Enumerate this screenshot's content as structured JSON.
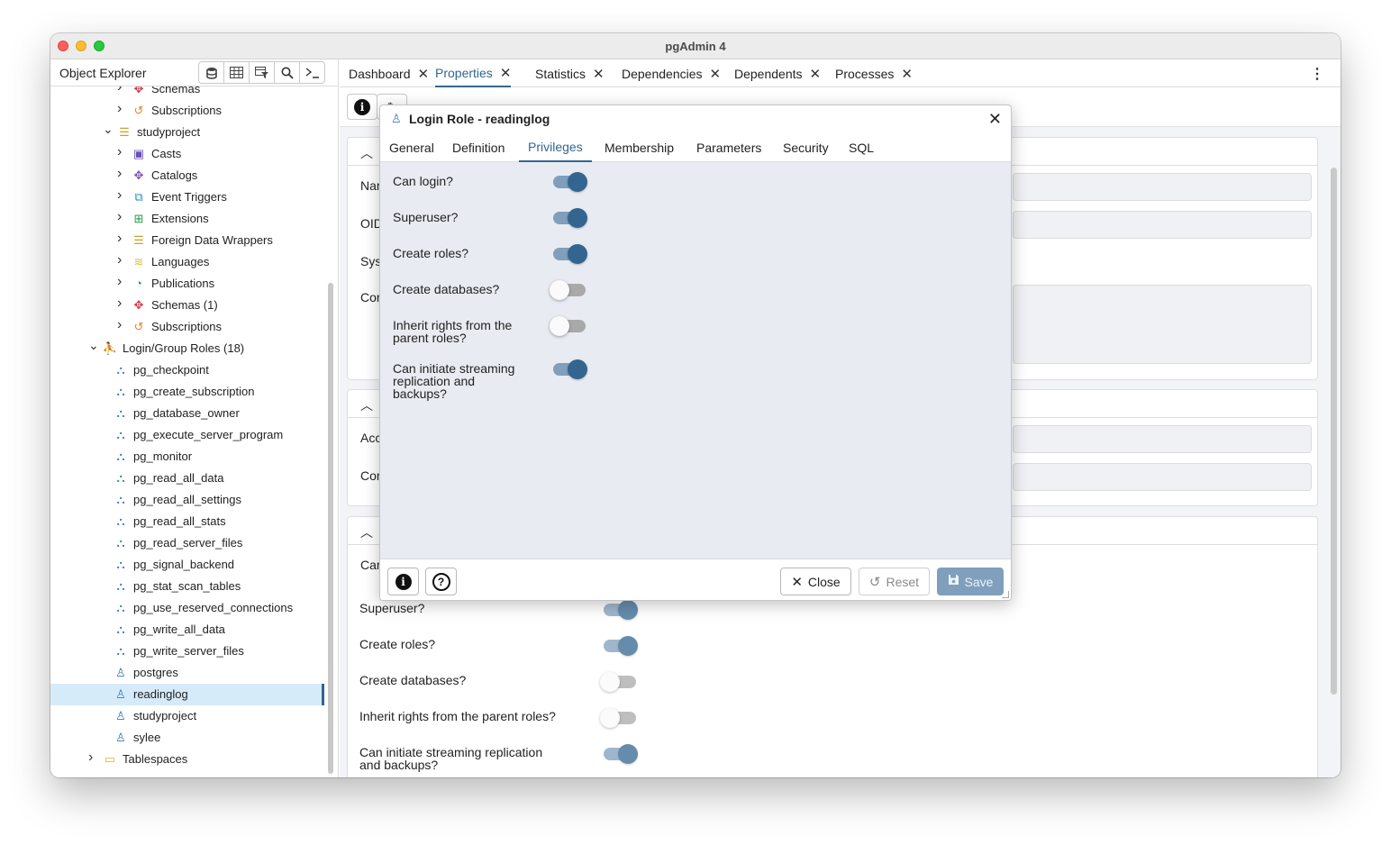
{
  "window": {
    "title": "pgAdmin 4"
  },
  "object_explorer": {
    "title": "Object Explorer",
    "tools": [
      "database-icon",
      "table-icon",
      "filter-icon",
      "search-icon",
      "terminal-icon"
    ],
    "tree": [
      {
        "label": "Schemas",
        "depth": 2,
        "twisty": ">",
        "icon": "schemas-icon",
        "glyph": "✥",
        "color": "#d6334a"
      },
      {
        "label": "Subscriptions",
        "depth": 2,
        "twisty": ">",
        "icon": "subscriptions-icon",
        "glyph": "↺",
        "color": "#e8862a"
      },
      {
        "label": "studyproject",
        "depth": 1,
        "twisty": "v",
        "icon": "database-icon",
        "glyph": "☰",
        "color": "#c9a227"
      },
      {
        "label": "Casts",
        "depth": 2,
        "twisty": ">",
        "icon": "casts-icon",
        "glyph": "▣",
        "color": "#6a4fb4"
      },
      {
        "label": "Catalogs",
        "depth": 2,
        "twisty": ">",
        "icon": "catalogs-icon",
        "glyph": "✥",
        "color": "#7a4fb8"
      },
      {
        "label": "Event Triggers",
        "depth": 2,
        "twisty": ">",
        "icon": "event-triggers-icon",
        "glyph": "⧉",
        "color": "#2a8fb8"
      },
      {
        "label": "Extensions",
        "depth": 2,
        "twisty": ">",
        "icon": "extensions-icon",
        "glyph": "⊞",
        "color": "#2a9a4a"
      },
      {
        "label": "Foreign Data Wrappers",
        "depth": 2,
        "twisty": ">",
        "icon": "foreign-data-wrappers-icon",
        "glyph": "☰",
        "color": "#c9a227"
      },
      {
        "label": "Languages",
        "depth": 2,
        "twisty": ">",
        "icon": "languages-icon",
        "glyph": "≋",
        "color": "#e0c020"
      },
      {
        "label": "Publications",
        "depth": 2,
        "twisty": ">",
        "icon": "publications-icon",
        "glyph": "◔",
        "color": "#4a6fb8"
      },
      {
        "label": "Schemas (1)",
        "depth": 2,
        "twisty": ">",
        "icon": "schemas-icon",
        "glyph": "✥",
        "color": "#d6334a"
      },
      {
        "label": "Subscriptions",
        "depth": 2,
        "twisty": ">",
        "icon": "subscriptions-icon",
        "glyph": "↺",
        "color": "#e8862a"
      },
      {
        "label": "Login/Group Roles (18)",
        "depth": 0,
        "twisty": "v",
        "icon": "login-group-roles-icon",
        "glyph": "⛹",
        "color": "#d6334a"
      },
      {
        "label": "pg_checkpoint",
        "depth": 1,
        "twisty": "",
        "icon": "group-role-icon",
        "glyph": "⛬",
        "color": "#3a7ab8"
      },
      {
        "label": "pg_create_subscription",
        "depth": 1,
        "twisty": "",
        "icon": "group-role-icon",
        "glyph": "⛬",
        "color": "#3a7ab8"
      },
      {
        "label": "pg_database_owner",
        "depth": 1,
        "twisty": "",
        "icon": "group-role-icon",
        "glyph": "⛬",
        "color": "#3a7ab8"
      },
      {
        "label": "pg_execute_server_program",
        "depth": 1,
        "twisty": "",
        "icon": "group-role-icon",
        "glyph": "⛬",
        "color": "#3a7ab8"
      },
      {
        "label": "pg_monitor",
        "depth": 1,
        "twisty": "",
        "icon": "group-role-icon",
        "glyph": "⛬",
        "color": "#3a7ab8"
      },
      {
        "label": "pg_read_all_data",
        "depth": 1,
        "twisty": "",
        "icon": "group-role-icon",
        "glyph": "⛬",
        "color": "#3a7ab8"
      },
      {
        "label": "pg_read_all_settings",
        "depth": 1,
        "twisty": "",
        "icon": "group-role-icon",
        "glyph": "⛬",
        "color": "#3a7ab8"
      },
      {
        "label": "pg_read_all_stats",
        "depth": 1,
        "twisty": "",
        "icon": "group-role-icon",
        "glyph": "⛬",
        "color": "#3a7ab8"
      },
      {
        "label": "pg_read_server_files",
        "depth": 1,
        "twisty": "",
        "icon": "group-role-icon",
        "glyph": "⛬",
        "color": "#3a7ab8"
      },
      {
        "label": "pg_signal_backend",
        "depth": 1,
        "twisty": "",
        "icon": "group-role-icon",
        "glyph": "⛬",
        "color": "#3a7ab8"
      },
      {
        "label": "pg_stat_scan_tables",
        "depth": 1,
        "twisty": "",
        "icon": "group-role-icon",
        "glyph": "⛬",
        "color": "#3a7ab8"
      },
      {
        "label": "pg_use_reserved_connections",
        "depth": 1,
        "twisty": "",
        "icon": "group-role-icon",
        "glyph": "⛬",
        "color": "#3a7ab8"
      },
      {
        "label": "pg_write_all_data",
        "depth": 1,
        "twisty": "",
        "icon": "group-role-icon",
        "glyph": "⛬",
        "color": "#3a7ab8"
      },
      {
        "label": "pg_write_server_files",
        "depth": 1,
        "twisty": "",
        "icon": "group-role-icon",
        "glyph": "⛬",
        "color": "#3a7ab8"
      },
      {
        "label": "postgres",
        "depth": 1,
        "twisty": "",
        "icon": "login-role-icon",
        "glyph": "♙",
        "color": "#3a7ab8"
      },
      {
        "label": "readinglog",
        "depth": 1,
        "twisty": "",
        "icon": "login-role-icon",
        "glyph": "♙",
        "color": "#3a7ab8",
        "selected": true
      },
      {
        "label": "studyproject",
        "depth": 1,
        "twisty": "",
        "icon": "login-role-icon",
        "glyph": "♙",
        "color": "#3a7ab8"
      },
      {
        "label": "sylee",
        "depth": 1,
        "twisty": "",
        "icon": "login-role-icon",
        "glyph": "♙",
        "color": "#3a7ab8"
      },
      {
        "label": "Tablespaces",
        "depth": 0,
        "twisty": ">",
        "icon": "tablespaces-icon",
        "glyph": "▭",
        "color": "#e0b520"
      }
    ]
  },
  "tabs": [
    {
      "label": "Dashboard",
      "active": false
    },
    {
      "label": "Properties",
      "active": true
    },
    {
      "label": "Statistics",
      "active": false
    },
    {
      "label": "Dependencies",
      "active": false
    },
    {
      "label": "Dependents",
      "active": false
    },
    {
      "label": "Processes",
      "active": false
    }
  ],
  "properties": {
    "general_labels": [
      "Nar",
      "OID",
      "Sys",
      "Cor"
    ],
    "definition_labels": [
      "Acc",
      "Cor"
    ],
    "privileges_partial_label": "Car",
    "privileges": [
      {
        "label": "Superuser?",
        "on": true
      },
      {
        "label": "Create roles?",
        "on": true
      },
      {
        "label": "Create databases?",
        "on": false
      },
      {
        "label": "Inherit rights from the parent roles?",
        "on": false
      },
      {
        "label": "Can initiate streaming replication and backups?",
        "on": true
      }
    ]
  },
  "dialog": {
    "title": "Login Role - readinglog",
    "tabs": [
      "General",
      "Definition",
      "Privileges",
      "Membership",
      "Parameters",
      "Security",
      "SQL"
    ],
    "active_tab": "Privileges",
    "fields": [
      {
        "label": "Can login?",
        "on": true
      },
      {
        "label": "Superuser?",
        "on": true
      },
      {
        "label": "Create roles?",
        "on": true
      },
      {
        "label": "Create databases?",
        "on": false
      },
      {
        "label": "Inherit rights from the parent roles?",
        "on": false
      },
      {
        "label": "Can initiate streaming replication and backups?",
        "on": true
      }
    ],
    "footer": {
      "close": "Close",
      "reset": "Reset",
      "save": "Save"
    }
  }
}
